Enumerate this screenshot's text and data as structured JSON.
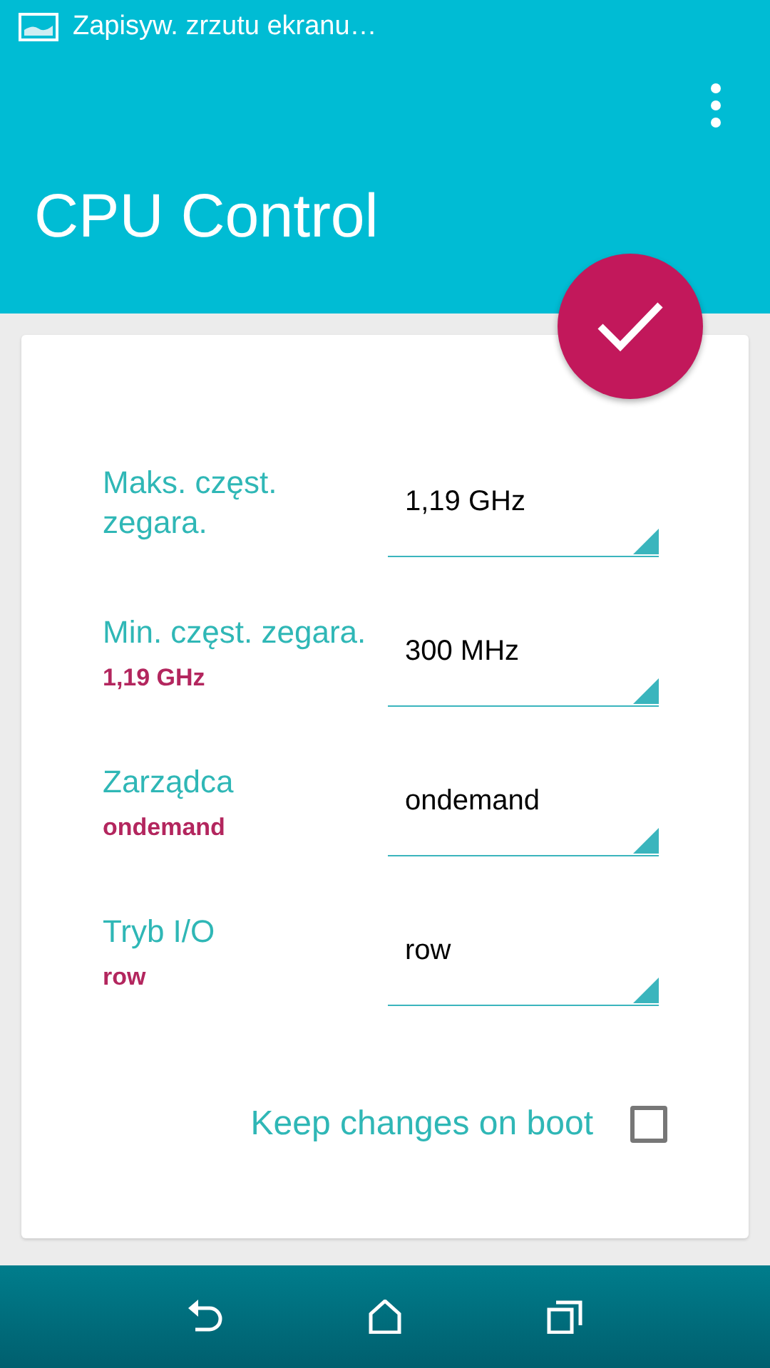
{
  "status_bar": {
    "notification": "Zapisyw. zrzutu ekranu…"
  },
  "app_bar": {
    "title": "CPU Control"
  },
  "settings": [
    {
      "label": "Maks. częst. zegara.",
      "value": "1,19 GHz"
    },
    {
      "label": "Min. częst. zegara.",
      "current": "1,19 GHz",
      "value": "300 MHz"
    },
    {
      "label": "Zarządca",
      "current": "ondemand",
      "value": "ondemand"
    },
    {
      "label": "Tryb I/O",
      "current": "row",
      "value": "row"
    }
  ],
  "keep_on_boot": {
    "label": "Keep changes on boot",
    "checked": false
  }
}
